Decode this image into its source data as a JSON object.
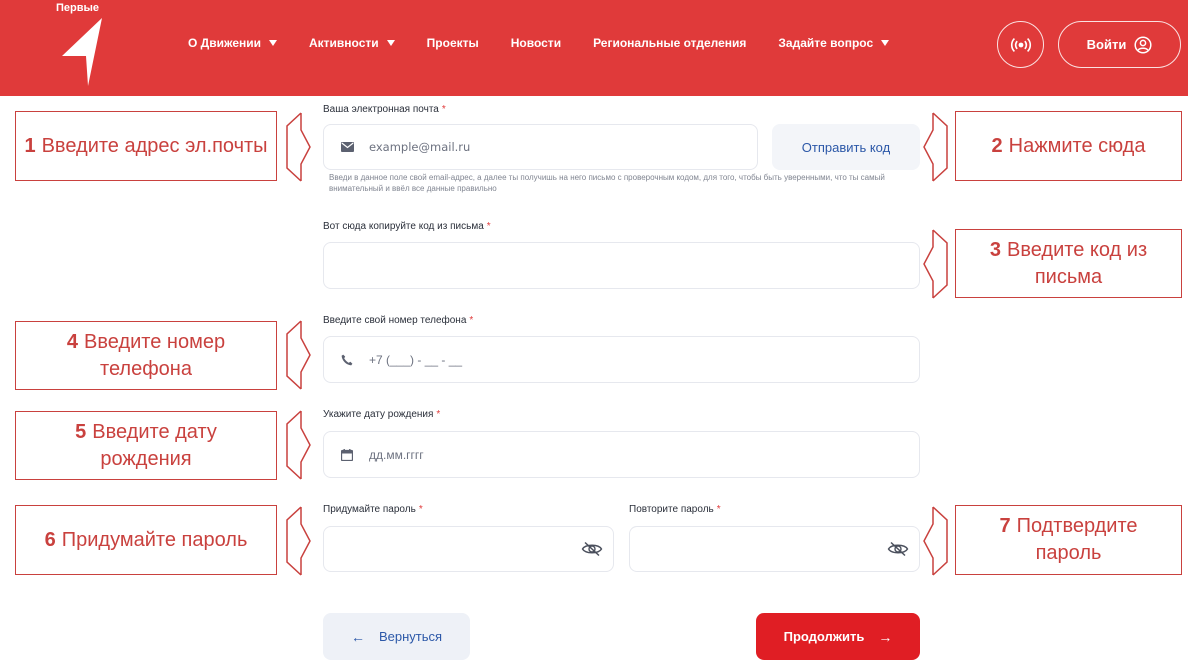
{
  "header": {
    "logo_text": "Первые",
    "nav": [
      {
        "label": "О Движении",
        "dropdown": true
      },
      {
        "label": "Активности",
        "dropdown": true
      },
      {
        "label": "Проекты",
        "dropdown": false
      },
      {
        "label": "Новости",
        "dropdown": false
      },
      {
        "label": "Региональные отделения",
        "dropdown": false
      },
      {
        "label": "Задайте вопрос",
        "dropdown": true
      }
    ],
    "login_label": "Войти",
    "accent_color": "#e03a3a"
  },
  "form": {
    "email": {
      "label": "Ваша электронная почта",
      "placeholder": "example@mail.ru",
      "hint": "Введи в данное поле свой email-адрес, а далее ты получишь на него письмо с проверочным кодом, для того, чтобы быть уверенными, что ты самый внимательный и ввёл все данные правильно",
      "send_code_label": "Отправить код"
    },
    "code": {
      "label": "Вот сюда копируйте код из письма",
      "value": ""
    },
    "phone": {
      "label": "Введите свой номер телефона",
      "placeholder": "+7 (___) - __ - __"
    },
    "birthdate": {
      "label": "Укажите дату рождения",
      "placeholder": "дд.мм.гггг"
    },
    "password": {
      "label": "Придумайте пароль",
      "value": ""
    },
    "password_repeat": {
      "label": "Повторите пароль",
      "value": ""
    },
    "required_mark": "*",
    "back_label": "Вернуться",
    "continue_label": "Продолжить",
    "back_arrow": "←",
    "continue_arrow": "→"
  },
  "annotations": [
    {
      "num": "1",
      "text": "Введите адрес эл.почты"
    },
    {
      "num": "2",
      "text": "Нажмите сюда"
    },
    {
      "num": "3",
      "text": "Введите код из письма"
    },
    {
      "num": "4",
      "text": "Введите номер телефона"
    },
    {
      "num": "5",
      "text": "Введите дату рождения"
    },
    {
      "num": "6",
      "text": "Придумайте пароль"
    },
    {
      "num": "7",
      "text": "Подтвердите пароль"
    }
  ]
}
